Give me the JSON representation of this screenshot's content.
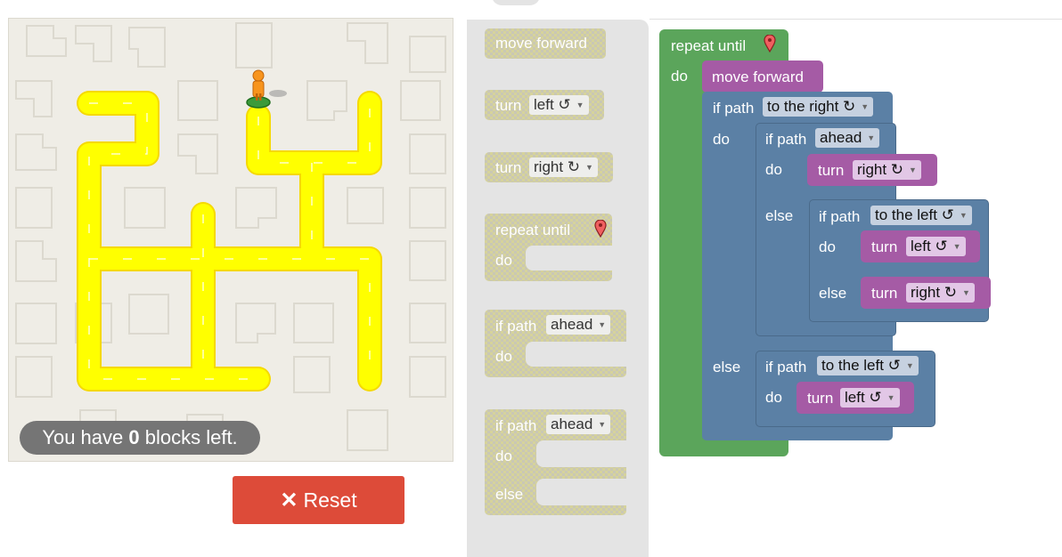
{
  "status": {
    "prefix": "You have ",
    "count": "0",
    "suffix": " blocks left."
  },
  "reset": {
    "icon": "✕",
    "label": "Reset"
  },
  "toolbox": {
    "move_forward": "move forward",
    "turn": "turn",
    "left": "left ↺",
    "right": "right ↻",
    "repeat_until": "repeat until",
    "do": "do",
    "if_path": "if path",
    "ahead": "ahead",
    "else": "else"
  },
  "workspace": {
    "repeat_until": "repeat until",
    "do": "do",
    "move_forward": "move forward",
    "if_path": "if path",
    "to_the_right": "to the right ↻",
    "to_the_left": "to the left ↺",
    "ahead": "ahead",
    "turn": "turn",
    "right": "right ↻",
    "left": "left ↺",
    "else": "else"
  },
  "colors": {
    "loop": "#5ba55b",
    "logic": "#5b80a5",
    "action": "#a55ba5",
    "path": "#ffff00",
    "reset": "#dd4b39"
  },
  "icons": {
    "goal": "map-marker-icon",
    "player": "pegman-icon",
    "reset": "close-icon"
  }
}
